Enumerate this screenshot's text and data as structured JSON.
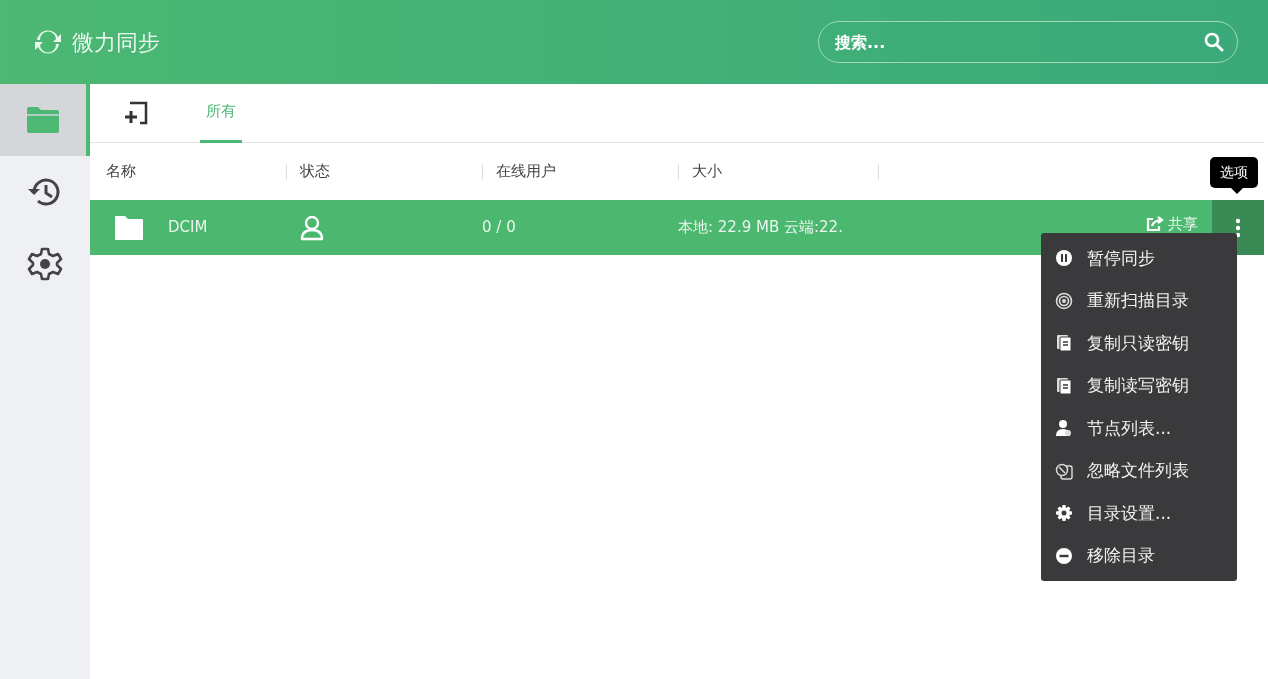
{
  "header": {
    "title": "微力同步",
    "search": {
      "placeholder": "搜索..."
    }
  },
  "sidebar": {
    "items": [
      {
        "kind": "folders",
        "selected": true
      },
      {
        "kind": "history",
        "selected": false
      },
      {
        "kind": "settings",
        "selected": false
      }
    ]
  },
  "tabs": [
    {
      "label": "所有",
      "selected": true
    }
  ],
  "table": {
    "columns": [
      "名称",
      "状态",
      "在线用户",
      "大小"
    ],
    "rows": [
      {
        "name": "DCIM",
        "online": "0 / 0",
        "size": "本地: 22.9 MB 云端:22.",
        "share": "共享",
        "selected": true
      }
    ]
  },
  "tooltip": "选项",
  "menu": [
    {
      "kind": "pause",
      "label": "暂停同步"
    },
    {
      "kind": "rescan",
      "label": "重新扫描目录"
    },
    {
      "kind": "copy",
      "label": "复制只读密钥"
    },
    {
      "kind": "copy",
      "label": "复制读写密钥"
    },
    {
      "kind": "nodes",
      "label": "节点列表..."
    },
    {
      "kind": "ignore",
      "label": "忽略文件列表"
    },
    {
      "kind": "settings",
      "label": "目录设置..."
    },
    {
      "kind": "remove",
      "label": "移除目录"
    }
  ]
}
